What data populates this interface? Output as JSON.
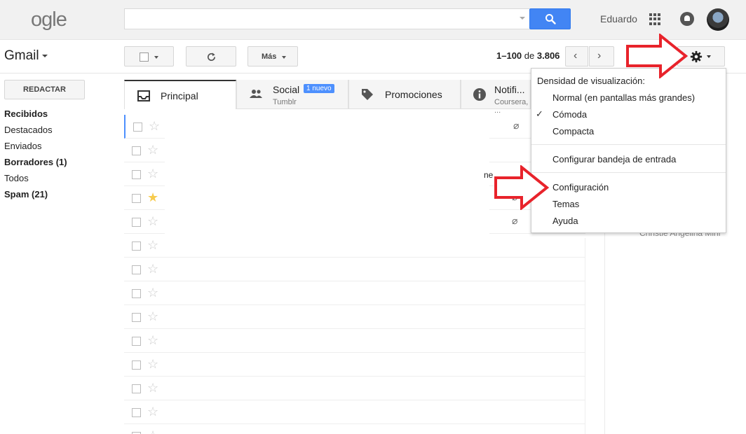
{
  "header": {
    "logo": "ogle",
    "user_name": "Eduardo"
  },
  "toolbar": {
    "app_label": "Gmail",
    "more_label": "Más",
    "paging_range": "1–100",
    "paging_of": "de",
    "paging_total": "3.806",
    "prev_glyph": "‹",
    "next_glyph": "›"
  },
  "sidebar": {
    "compose_label": "REDACTAR",
    "items": [
      {
        "label": "Recibidos",
        "bold": true
      },
      {
        "label": "Destacados",
        "bold": false
      },
      {
        "label": "Enviados",
        "bold": false
      },
      {
        "label": "Borradores (1)",
        "bold": true
      },
      {
        "label": "Todos",
        "bold": false
      },
      {
        "label": "Spam (21)",
        "bold": true
      }
    ]
  },
  "tabs": [
    {
      "label": "Principal",
      "sub": "",
      "badge": ""
    },
    {
      "label": "Social",
      "sub": "Tumblr",
      "badge": "1 nuevo"
    },
    {
      "label": "Promociones",
      "sub": "",
      "badge": ""
    },
    {
      "label": "Notifi...",
      "sub": "Coursera, ...",
      "badge": ""
    }
  ],
  "mail_list": {
    "fragment": "ne",
    "attachment_glyph": "⌀"
  },
  "right_panel": {
    "fragment": "Christie Angelina Mini"
  },
  "settings_menu": {
    "header": "Densidad de visualización:",
    "check_glyph": "✓",
    "items": {
      "normal": "Normal (en pantallas más grandes)",
      "comoda": "Cómoda",
      "compacta": "Compacta",
      "configurar_bandeja": "Configurar bandeja de entrada",
      "configuracion": "Configuración",
      "temas": "Temas",
      "ayuda": "Ayuda"
    }
  },
  "colors": {
    "accent_blue": "#4285f4",
    "arrow_red": "#e8232b",
    "star_yellow": "#f7cb4d"
  }
}
